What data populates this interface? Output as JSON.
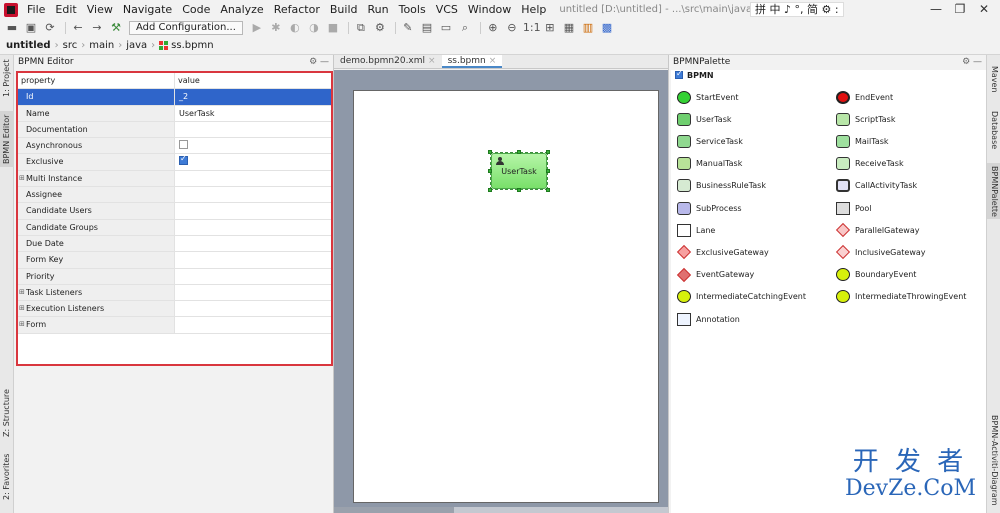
{
  "app": {
    "title": "untitled [D:\\untitled] - ...\\src\\main\\java\\ss.bpmn",
    "menu": [
      "File",
      "Edit",
      "View",
      "Navigate",
      "Code",
      "Analyze",
      "Refactor",
      "Build",
      "Run",
      "Tools",
      "VCS",
      "Window",
      "Help"
    ],
    "ime_text": "拼 中 ♪ °, 简 ⚙ :",
    "window_controls": [
      "—",
      "❐",
      "✕"
    ]
  },
  "toolbar": {
    "add_configuration": "Add Configuration..."
  },
  "breadcrumb": [
    "untitled",
    "src",
    "main",
    "java",
    "ss.bpmn"
  ],
  "left_stripe": {
    "tabs": [
      "1: Project",
      "BPMN Editor",
      "Z: Structure",
      "2: Favorites"
    ]
  },
  "right_stripe": {
    "tabs": [
      "Maven",
      "Database",
      "BPMNPalette",
      "BPMN-Activiti-Diagram"
    ]
  },
  "editor_panel": {
    "title": "BPMN Editor",
    "columns": {
      "property": "property",
      "value": "value"
    },
    "rows": [
      {
        "name": "Id",
        "value": "_2",
        "selected": true
      },
      {
        "name": "Name",
        "value": "UserTask"
      },
      {
        "name": "Documentation",
        "value": ""
      },
      {
        "name": "Asynchronous",
        "value": "",
        "checkbox": false
      },
      {
        "name": "Exclusive",
        "value": "",
        "checkbox": true
      },
      {
        "name": "Multi Instance",
        "value": "",
        "expandable": true
      },
      {
        "name": "Assignee",
        "value": ""
      },
      {
        "name": "Candidate Users",
        "value": ""
      },
      {
        "name": "Candidate Groups",
        "value": ""
      },
      {
        "name": "Due Date",
        "value": ""
      },
      {
        "name": "Form Key",
        "value": ""
      },
      {
        "name": "Priority",
        "value": ""
      },
      {
        "name": "Task Listeners",
        "value": "",
        "expandable": true
      },
      {
        "name": "Execution Listeners",
        "value": "",
        "expandable": true
      },
      {
        "name": "Form",
        "value": "",
        "expandable": true
      }
    ]
  },
  "editor_tabs": [
    {
      "label": "demo.bpmn20.xml",
      "active": false
    },
    {
      "label": "ss.bpmn",
      "active": true
    }
  ],
  "diagram": {
    "task_label": "UserTask"
  },
  "palette": {
    "title": "BPMNPalette",
    "group": "BPMN",
    "items": [
      {
        "label": "StartEvent",
        "icon": "start-event-icon"
      },
      {
        "label": "EndEvent",
        "icon": "end-event-icon"
      },
      {
        "label": "UserTask",
        "icon": "user-task-icon"
      },
      {
        "label": "ScriptTask",
        "icon": "script-task-icon"
      },
      {
        "label": "ServiceTask",
        "icon": "service-task-icon"
      },
      {
        "label": "MailTask",
        "icon": "mail-task-icon"
      },
      {
        "label": "ManualTask",
        "icon": "manual-task-icon"
      },
      {
        "label": "ReceiveTask",
        "icon": "receive-task-icon"
      },
      {
        "label": "BusinessRuleTask",
        "icon": "business-rule-task-icon"
      },
      {
        "label": "CallActivityTask",
        "icon": "call-activity-task-icon"
      },
      {
        "label": "SubProcess",
        "icon": "sub-process-icon"
      },
      {
        "label": "Pool",
        "icon": "pool-icon"
      },
      {
        "label": "Lane",
        "icon": "lane-icon"
      },
      {
        "label": "ParallelGateway",
        "icon": "parallel-gateway-icon"
      },
      {
        "label": "ExclusiveGateway",
        "icon": "exclusive-gateway-icon"
      },
      {
        "label": "InclusiveGateway",
        "icon": "inclusive-gateway-icon"
      },
      {
        "label": "EventGateway",
        "icon": "event-gateway-icon"
      },
      {
        "label": "BoundaryEvent",
        "icon": "boundary-event-icon"
      },
      {
        "label": "IntermediateCatchingEvent",
        "icon": "intermediate-catching-event-icon"
      },
      {
        "label": "IntermediateThrowingEvent",
        "icon": "intermediate-throwing-event-icon"
      },
      {
        "label": "Annotation",
        "icon": "annotation-icon"
      }
    ]
  },
  "watermark": {
    "line1": "开 发 者",
    "line2": "DevZe.CoM"
  },
  "colors": {
    "selection": "#2f65ca",
    "highlight_border": "#d9363e",
    "task_fill": "#93e884"
  }
}
